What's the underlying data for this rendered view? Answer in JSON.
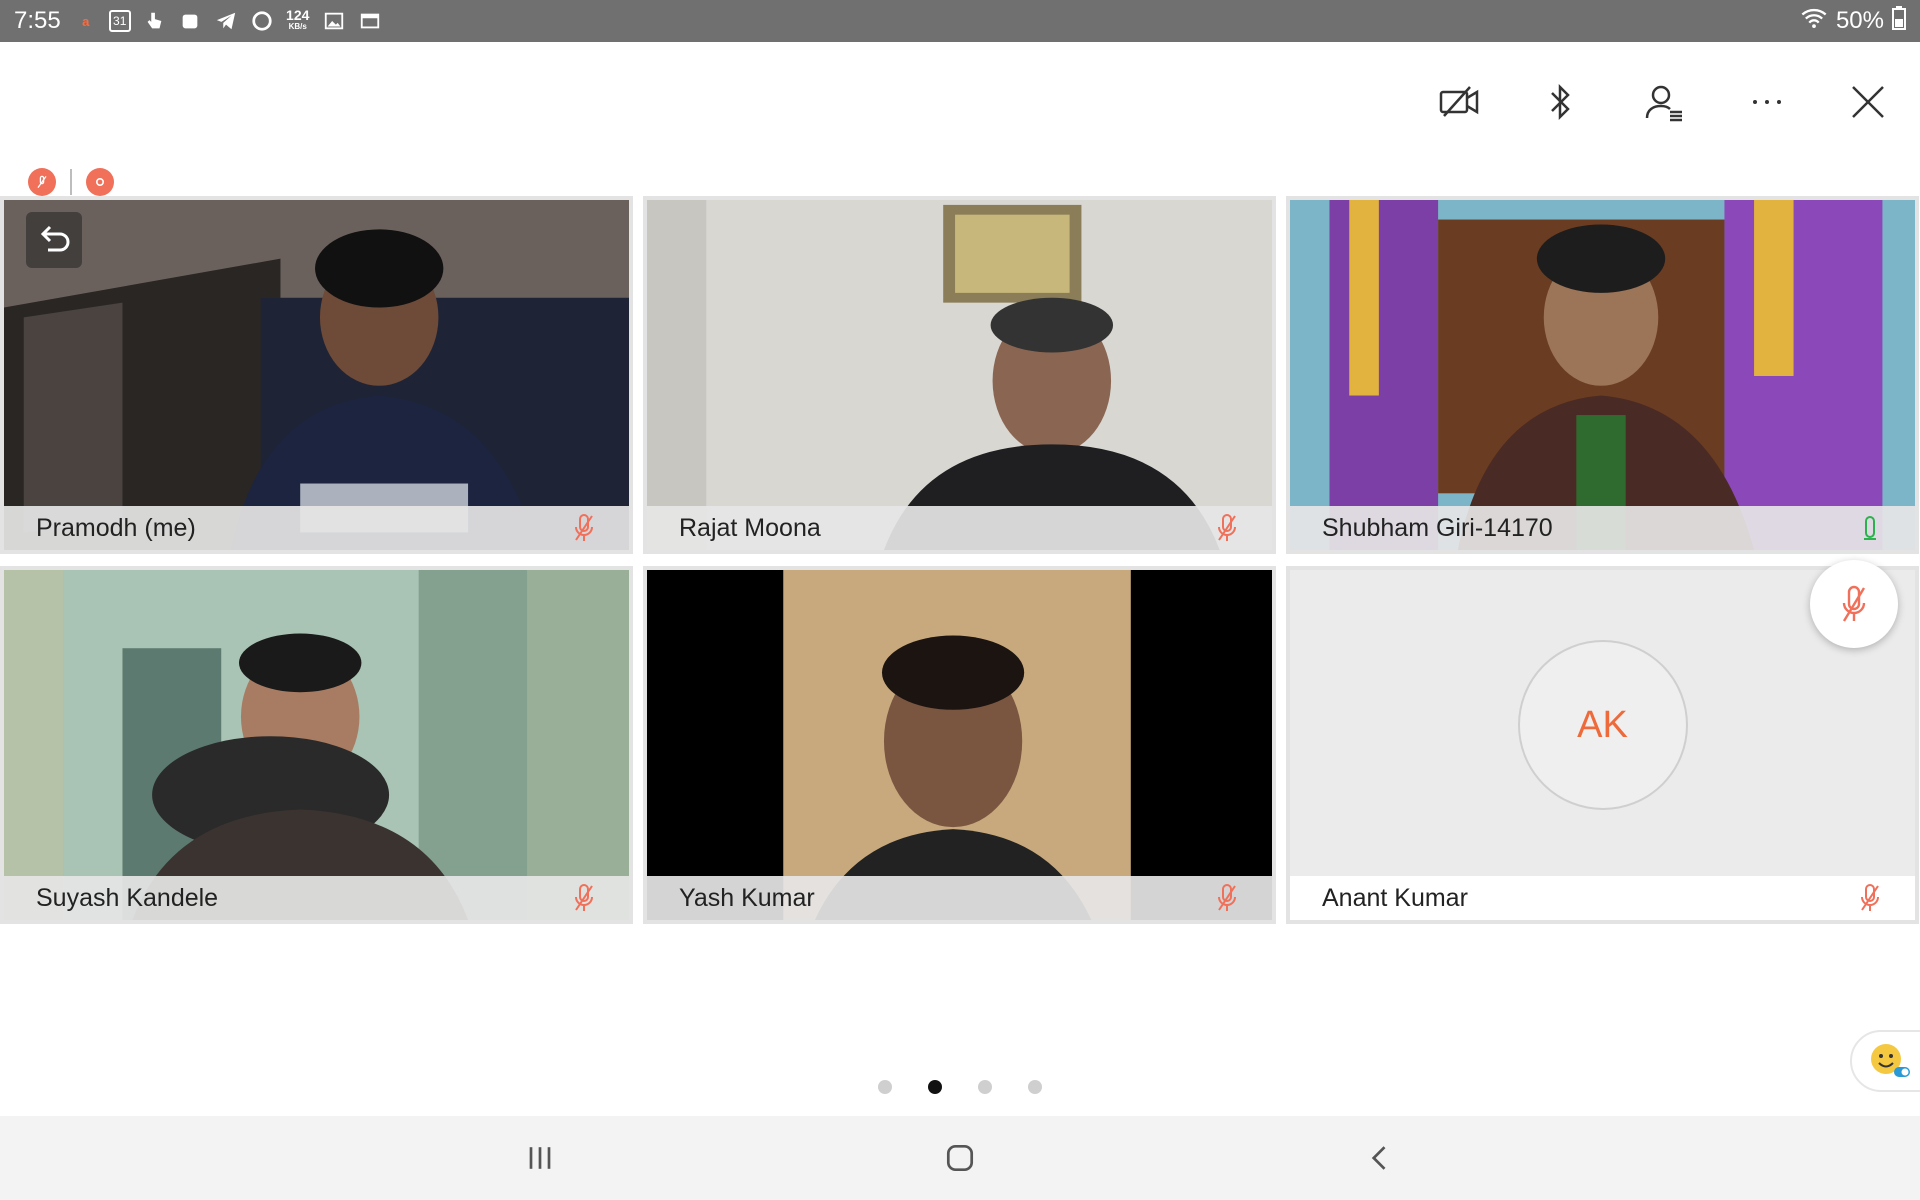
{
  "status_bar": {
    "time": "7:55",
    "net_speed_value": "124",
    "net_speed_unit": "KB/s",
    "calendar_day": "31",
    "battery": "50%",
    "icons": [
      "airtel-icon",
      "calendar-icon",
      "touch-icon",
      "store-icon",
      "telegram-icon",
      "refresh-icon",
      "netspeed-icon",
      "gallery-icon",
      "screen-icon",
      "wifi-icon",
      "battery-icon"
    ]
  },
  "toolbar": {
    "icons": [
      "video-off-icon",
      "bluetooth-icon",
      "participants-icon",
      "more-icon",
      "close-icon"
    ]
  },
  "badges": {
    "icons": [
      "muted-mic-badge-icon",
      "record-badge-icon"
    ]
  },
  "participants": [
    {
      "name": "Pramodh (me)",
      "mic": "muted",
      "has_back_button": true
    },
    {
      "name": "Rajat Moona",
      "mic": "muted"
    },
    {
      "name": "Shubham Giri-14170",
      "mic": "active"
    },
    {
      "name": "Suyash Kandele",
      "mic": "muted"
    },
    {
      "name": "Yash Kumar",
      "mic": "muted"
    },
    {
      "name": "Anant Kumar",
      "mic": "muted",
      "initials": "AK"
    }
  ],
  "pagination": {
    "pages": 4,
    "active_index": 1
  },
  "colors": {
    "accent": "#ef6a3a",
    "mute_red": "#f0705a",
    "mic_green": "#2bb24c"
  },
  "nav": {
    "icons": [
      "recent-apps-icon",
      "home-icon",
      "back-icon"
    ]
  }
}
